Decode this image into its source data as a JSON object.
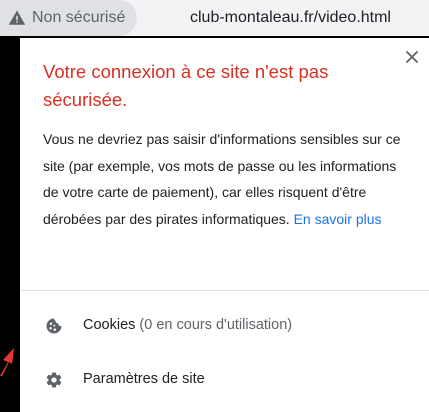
{
  "addressbar": {
    "security_label": "Non sécurisé",
    "url": "club-montaleau.fr/video.html"
  },
  "popup": {
    "title": "Votre connexion à ce site n'est pas sécurisée.",
    "description": "Vous ne devriez pas saisir d'informations sensibles sur ce site (par exemple, vos mots de passe ou les informations de votre carte de paiement), car elles risquent d'être dérobées par des pirates informatiques.",
    "learn_more": "En savoir plus",
    "cookies_label": "Cookies",
    "cookies_count": "(0 en cours d'utilisation)",
    "settings_label": "Paramètres de site"
  },
  "icons": {
    "warning": "warning-triangle-icon",
    "close": "close-icon",
    "cookie": "cookie-icon",
    "settings": "gear-icon",
    "annotation": "red-arrow-icon"
  },
  "colors": {
    "title_red": "#d93025",
    "link_blue": "#1a73e8",
    "text": "#202124",
    "muted": "#5f6368"
  }
}
